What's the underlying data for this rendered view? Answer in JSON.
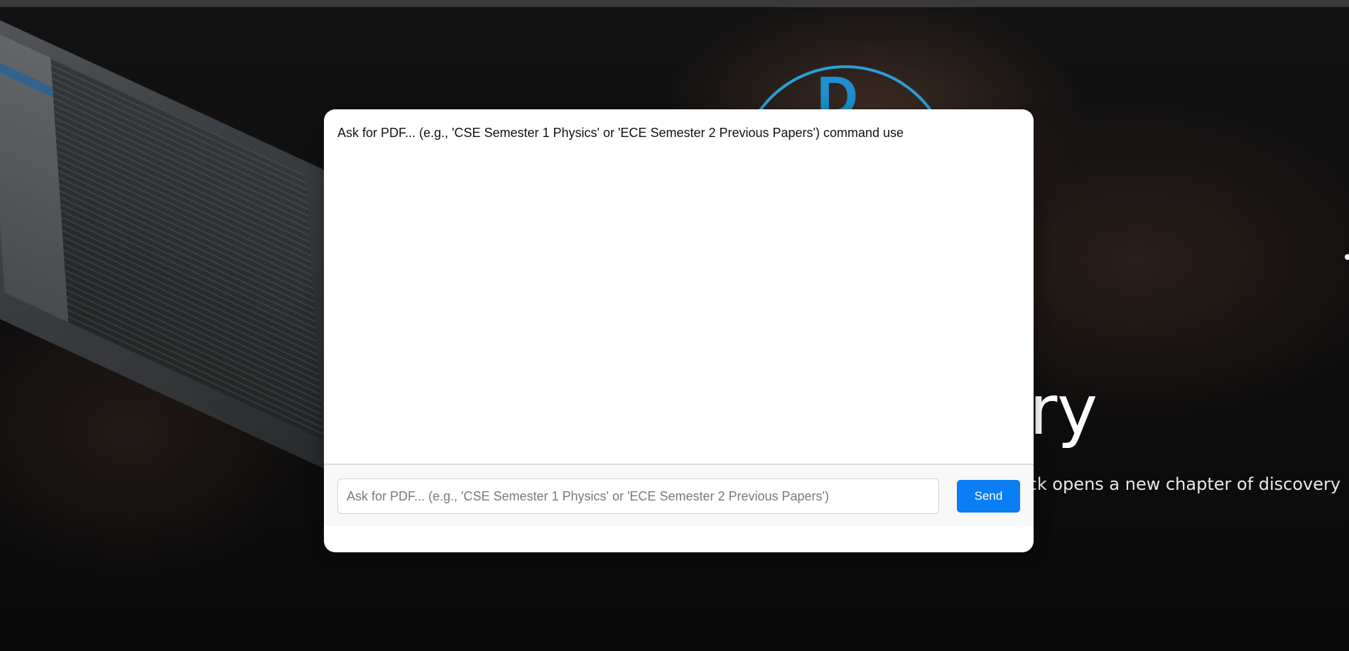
{
  "hero": {
    "title_fragment": "ary",
    "subtitle_fragment": "ick opens a new chapter of discovery"
  },
  "chat": {
    "message": "Ask for PDF... (e.g., 'CSE Semester 1 Physics' or 'ECE Semester 2 Previous Papers') command use",
    "input_value": "",
    "input_placeholder": "Ask for PDF... (e.g., 'CSE Semester 1 Physics' or 'ECE Semester 2 Previous Papers')",
    "send_label": "Send"
  },
  "colors": {
    "send_button": "#0a7ef2",
    "logo_ring": "#2a9fd8",
    "modal_bg": "#ffffff",
    "input_bar_bg": "#f8f8f8"
  }
}
